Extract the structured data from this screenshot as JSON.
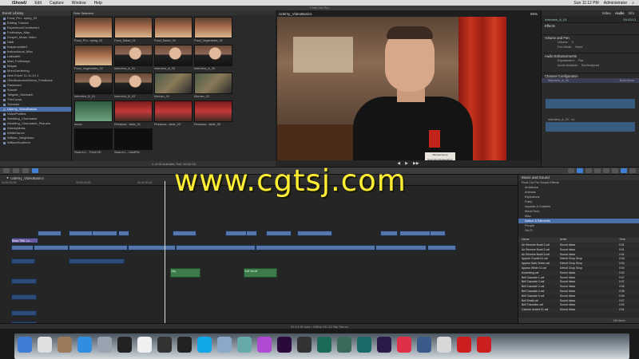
{
  "menubar": {
    "app": "iShowU",
    "items": [
      "Edit",
      "Capture",
      "Window",
      "Help"
    ],
    "clock": "Sun 11:12 PM",
    "user": "Administrator"
  },
  "window": {
    "title": "Final Cut Pro"
  },
  "library": {
    "header": "Event Library",
    "events": [
      "Food_Pro...sping_03",
      "Editing Tutorial",
      "EsperienceCreativeIn1",
      "Forthways_Map",
      "Gospel_Music Video",
      "Haiti",
      "Inappropriate1",
      "Instructional_Misc",
      "LatitudeIt",
      "Mad_Forthways",
      "Magas",
      "MomGardening",
      "New Event 11-11-14 1",
      "OhioBusinessVideos_Feedback",
      "Password",
      "Sunset",
      "Tailgate_Outreach",
      "TheCrows",
      "Tutorials",
      "Udemy_VideoBasics",
      "VideoProfiles",
      "Wedding_Charmaine",
      "Wedding_Charmaine_Pictures",
      "WesleyMelts",
      "WhiteDance",
      "William_Neighbors",
      "WilliamSouthern"
    ],
    "selected_index": 19
  },
  "browser": {
    "header": "Role Selected",
    "footer": "1 of 18 selected, Full: 00:42:15",
    "clips": [
      {
        "label": "Food_Pro...sping_03"
      },
      {
        "label": "Food_Salad_01"
      },
      {
        "label": "Food_Salad_03"
      },
      {
        "label": "Food_Vegetables_01"
      },
      {
        "label": "Food_Vegetables_02"
      },
      {
        "label": "Interview_A_01"
      },
      {
        "label": "Interview_A_03"
      },
      {
        "label": "Interview_A_05"
      },
      {
        "label": "Interview_B_01"
      },
      {
        "label": "Interview_B_03"
      },
      {
        "label": "Kitchen_01"
      },
      {
        "label": "Kitchen_02"
      },
      {
        "label": "music"
      },
      {
        "label": "Restaura...tside_01"
      },
      {
        "label": "Restaura...tside_03"
      },
      {
        "label": "Restaura...tside_05"
      },
      {
        "label": "Swarm-L...Third.HD"
      },
      {
        "label": "Swarm-L...hardFtlx"
      }
    ]
  },
  "viewer": {
    "title": "Udemy_VideoBasics",
    "zoom": "55%",
    "tag_line1": "Michael Kemp",
    "tag_line2": "Executive Restaurateur"
  },
  "inspector": {
    "tabs": [
      "Video",
      "Audio",
      "Info"
    ],
    "clip_name": "Interview_A_01",
    "timecode": "00:03:13",
    "sections": [
      "Effects",
      "Volume and Pan",
      "Audio Enhancements",
      "Channel Configuration"
    ],
    "volume_label": "Volume:",
    "volume_value": "0",
    "pan_label": "Pan Mode:",
    "pan_value": "None",
    "eq_label": "Equalization:",
    "eq_value": "Flat",
    "analysis_label": "Audio Analysis:",
    "analysis_value": "Not Analyzed",
    "channel_name": "Interview_A_01",
    "channel_mode": "Dual Mono",
    "channel_track": "Interview_A_01 - s1"
  },
  "timeline": {
    "project": "Udemy_VideoBasics",
    "ruler": [
      "00:00:00:00",
      "00:00:15:00",
      "00:00:30:00",
      "00:00:45:00",
      "00:01:00:00",
      "00:01:15:00"
    ],
    "clips_title": [
      "Basic Title: Lo...",
      "Interview_B...",
      "Interview_B..."
    ],
    "audio_clips": [
      "City",
      "Soft Scroll"
    ]
  },
  "status": "01:14:15 total • 1080p HD 23.98p Stereo",
  "watermark": "www.cgtsj.com",
  "media": {
    "header": "Music and Sound",
    "categories": [
      "Final Cut Pro Sound Effects",
      "Ambience",
      "Animals",
      "Explosions",
      "Foley",
      "Impacts & Crashes",
      "Mech/Tech",
      "Misc",
      "Nature & Elements",
      "People",
      "Sci-Fi"
    ],
    "selected_category": 8,
    "columns": [
      "Name",
      "Artist",
      "Time"
    ],
    "items": [
      {
        "name": "Air Reverse Burst 1.caf",
        "artist": "Sound Ideas",
        "time": "0:01"
      },
      {
        "name": "Air Reverse Burst 2.caf",
        "artist": "Sound Ideas",
        "time": "0:01"
      },
      {
        "name": "Air Reverse Burst 3.caf",
        "artist": "Sound Ideas",
        "time": "0:01"
      },
      {
        "name": "Appear Crystal 01.caf",
        "artist": "Detroit Chop Shop",
        "time": "0:04"
      },
      {
        "name": "Appear Dark Green.caf",
        "artist": "Detroit Chop Shop",
        "time": "0:04"
      },
      {
        "name": "Appear White 01.caf",
        "artist": "Detroit Chop Shop",
        "time": "0:04"
      },
      {
        "name": "Ascending.caf",
        "artist": "Sound Ideas",
        "time": "0:02"
      },
      {
        "name": "Bell Cascade 1.caf",
        "artist": "Sound Ideas",
        "time": "0:07"
      },
      {
        "name": "Bell Cascade 2.caf",
        "artist": "Sound Ideas",
        "time": "0:07"
      },
      {
        "name": "Bell Cascade 3.caf",
        "artist": "Sound Ideas",
        "time": "0:05"
      },
      {
        "name": "Bell Cascade 4.caf",
        "artist": "Sound Ideas",
        "time": "0:06"
      },
      {
        "name": "Bell Cascade 5.caf",
        "artist": "Sound Ideas",
        "time": "0:06"
      },
      {
        "name": "Bell Small.caf",
        "artist": "Sound Ideas",
        "time": "0:07"
      },
      {
        "name": "Bell Transition.caf",
        "artist": "Sound Ideas",
        "time": "0:02"
      },
      {
        "name": "Cartoon Accent 01.caf",
        "artist": "Sound Ideas",
        "time": "0:01"
      }
    ],
    "count": "184 items"
  },
  "dock": {
    "icons": [
      "finder-icon",
      "chrome-icon",
      "contacts-icon",
      "app-store-icon",
      "launchpad-icon",
      "unity-icon",
      "calendar-icon",
      "clapper-icon",
      "dvd-icon",
      "skype-icon",
      "mail-icon",
      "photos-icon",
      "itunes-icon",
      "premiere-icon",
      "final-cut-icon",
      "motion-icon",
      "compressor-icon",
      "audition-icon",
      "after-effects-icon",
      "music-icon",
      "dashboard-icon",
      "preview-icon",
      "roblox-icon",
      "trash-icon"
    ]
  }
}
